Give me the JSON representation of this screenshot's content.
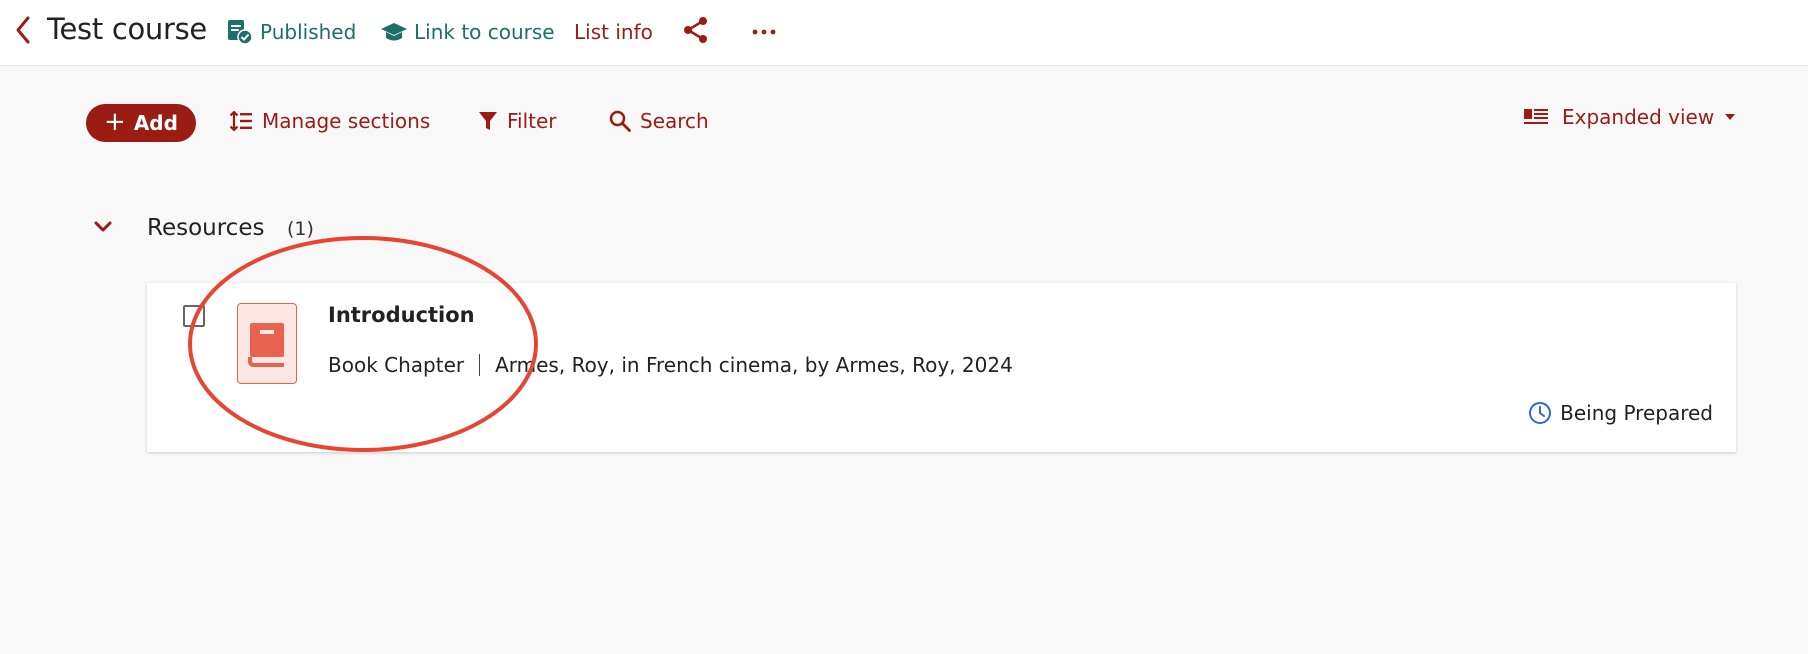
{
  "header": {
    "title": "Test course",
    "published_label": "Published",
    "link_label": "Link to course",
    "list_info_label": "List info"
  },
  "toolbar": {
    "add_label": "Add",
    "manage_label": "Manage sections",
    "filter_label": "Filter",
    "search_label": "Search",
    "view_label": "Expanded view"
  },
  "section": {
    "title": "Resources",
    "count": "(1)",
    "items": [
      {
        "title": "Introduction",
        "type": "Book Chapter",
        "citation": "Armes, Roy, in French cinema, by Armes, Roy, 2024",
        "status": "Being Prepared"
      }
    ]
  },
  "colors": {
    "brand": "#9b1c12",
    "teal": "#1d6f68",
    "annotation": "#e8442f",
    "status_icon": "#2a6bd1",
    "book_icon": "#e8624f"
  },
  "icons": {
    "back": "chevron-left-icon",
    "published": "document-check-icon",
    "link": "graduation-cap-icon",
    "share": "share-icon",
    "more": "ellipsis-icon",
    "manage": "sort-list-icon",
    "filter": "funnel-icon",
    "search": "magnifier-icon",
    "view": "expanded-list-icon",
    "section_toggle": "chevron-down-icon",
    "resource": "book-icon",
    "status": "clock-icon"
  }
}
